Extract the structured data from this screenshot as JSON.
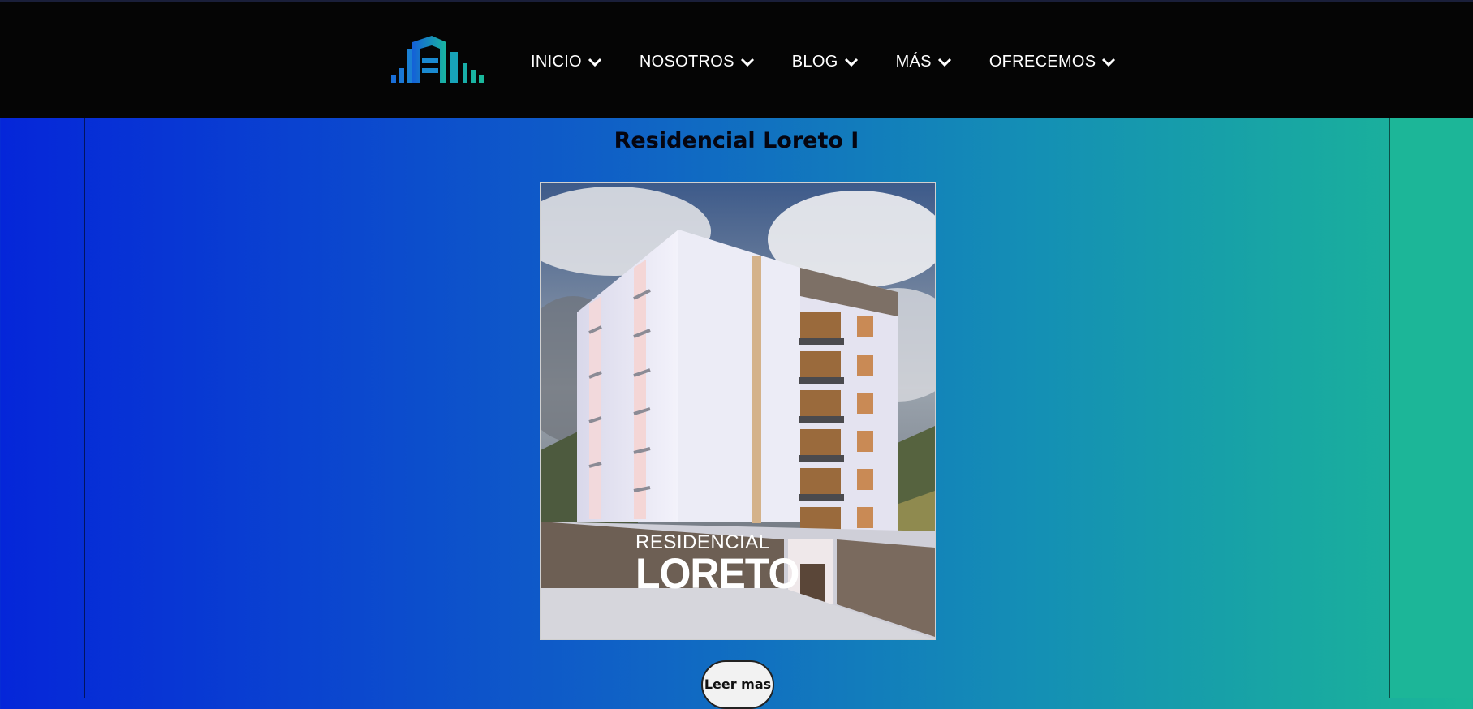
{
  "header": {
    "logo_icon": "building-logo-icon",
    "nav": [
      {
        "label": "INICIO",
        "icon": "chevron-down-icon"
      },
      {
        "label": "NOSOTROS",
        "icon": "chevron-down-icon"
      },
      {
        "label": "BLOG",
        "icon": "chevron-down-icon"
      },
      {
        "label": "MÁS",
        "icon": "chevron-down-icon"
      },
      {
        "label": "OFRECEMOS",
        "icon": "chevron-down-icon"
      }
    ]
  },
  "main": {
    "title": "Residencial Loreto I",
    "image": {
      "sign_line1": "RESIDENCIAL",
      "sign_line2": "LORETO"
    },
    "read_more_label": "Leer mas"
  },
  "colors": {
    "navbar_bg": "#050505",
    "gradient_start": "#0526d9",
    "gradient_end": "#1bb797",
    "logo_blue": "#1a7fd6",
    "logo_teal": "#19b6a0"
  }
}
